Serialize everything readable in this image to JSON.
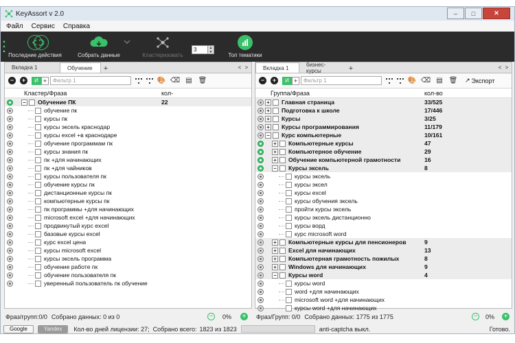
{
  "window": {
    "title": "KeyAssort v 2.0",
    "min": "–",
    "max": "□",
    "close": "✕"
  },
  "menu": [
    "Файл",
    "Сервис",
    "Справка"
  ],
  "toolbar": {
    "recent": "Последние действия",
    "collect": "Собрать данные",
    "cluster": "Кластеризовать",
    "cluster_value": "3",
    "top": "Топ тематики",
    "colors": {
      "bg": "#2b2b2b",
      "accent": "#3bc06a"
    }
  },
  "left": {
    "tabs": [
      "Вкладка 1",
      "Обучение"
    ],
    "filter_placeholder": "Фильтр 1",
    "and_label": "И",
    "col1": "Кластер/Фраза",
    "col2": "кол-",
    "group": {
      "label": "Обучение ПК",
      "count": "22"
    },
    "items": [
      "обучение пк",
      "курсы пк",
      "курсы эксель краснодар",
      "курсы excel +в краснодаре",
      "обучение программам пк",
      "курсы знания пк",
      "пк +для начинающих",
      "пк +для чайников",
      "курсы пользователя пк",
      "обучение курсы пк",
      "дистанционные курсы пк",
      "компьютерные курсы пк",
      "пк программы +для начинающих",
      "microsoft excel +для начинающих",
      "продвинутый курс excel",
      "базовые курсы excel",
      "курс excel цена",
      "курсы microsoft excel",
      "курсы эксель программа",
      "обучение работе пк",
      "обучение пользователя пк",
      "уверенный пользователь пк обучение"
    ],
    "status": "Фраз/групп:0/0",
    "collected": "Собрано данных: 0 из 0",
    "zoom": "0%"
  },
  "right": {
    "tabs": [
      "Вкладка 1",
      "бизнес-курсы"
    ],
    "filter_placeholder": "Фильтр 1",
    "and_label": "И",
    "export": "Экспорт",
    "col1": "Группа/Фраза",
    "col2": "кол-во",
    "rows": [
      {
        "type": "group",
        "label": "Главная страница",
        "count": "33/525",
        "dot": "grey"
      },
      {
        "type": "group",
        "label": "Подготовка к школе",
        "count": "17/446",
        "dot": "grey"
      },
      {
        "type": "group",
        "label": "Курсы",
        "count": "3/25",
        "dot": "grey"
      },
      {
        "type": "group",
        "label": "Курсы программирования",
        "count": "11/179",
        "dot": "grey"
      },
      {
        "type": "group",
        "label": "Курс компьютерные",
        "count": "10/161",
        "dot": "grey",
        "open": true
      },
      {
        "type": "sub",
        "label": "Компьютерные курсы",
        "count": "47",
        "dot": "green"
      },
      {
        "type": "sub",
        "label": "Компьютерное обучение",
        "count": "29",
        "dot": "green"
      },
      {
        "type": "sub",
        "label": "Обучение компьютерной грамотности",
        "count": "16",
        "dot": "green"
      },
      {
        "type": "sub",
        "label": "Курсы эксель",
        "count": "8",
        "dot": "green",
        "open": true
      },
      {
        "type": "leaf",
        "label": "курсы эксель",
        "dot": "grey"
      },
      {
        "type": "leaf",
        "label": "курсы эксел",
        "dot": "grey"
      },
      {
        "type": "leaf",
        "label": "курсы excel",
        "dot": "grey"
      },
      {
        "type": "leaf",
        "label": "курсы обучения эксель",
        "dot": "grey"
      },
      {
        "type": "leaf",
        "label": "пройти курсы эксель",
        "dot": "grey"
      },
      {
        "type": "leaf",
        "label": "курсы эксель дистанционно",
        "dot": "grey"
      },
      {
        "type": "leaf",
        "label": "курсы ворд",
        "dot": "grey"
      },
      {
        "type": "leaf",
        "label": "курс microsoft word",
        "dot": "grey"
      },
      {
        "type": "sub",
        "label": "Компьютерные курсы для пенсионеров",
        "count": "9",
        "dot": "grey"
      },
      {
        "type": "sub",
        "label": "Excel для начинающих",
        "count": "13",
        "dot": "grey"
      },
      {
        "type": "sub",
        "label": "Компьютерная грамотность пожилых",
        "count": "8",
        "dot": "grey"
      },
      {
        "type": "sub",
        "label": "Windows для начинающих",
        "count": "9",
        "dot": "grey"
      },
      {
        "type": "sub",
        "label": "Курсы word",
        "count": "4",
        "dot": "grey",
        "open": true
      },
      {
        "type": "leaf",
        "label": "курсы word",
        "dot": "grey"
      },
      {
        "type": "leaf",
        "label": "word +для начинающих",
        "dot": "grey"
      },
      {
        "type": "leaf",
        "label": "microsoft word +для начинающих",
        "dot": "grey"
      },
      {
        "type": "leaf",
        "label": "курсы word +для начинающих",
        "dot": "grey"
      }
    ],
    "status": "Фраз/Групп: 0/0",
    "collected": "Собрано данных: 1775 из 1775",
    "zoom": "0%"
  },
  "bottom": {
    "google": "Google",
    "yandex": "Yandex",
    "license": "Кол-во дней лицензии: 27;",
    "total": "Собрано всего:",
    "total_value": "1823 из 1823",
    "captcha": "anti-captcha выкл.",
    "ready": "Готово."
  }
}
